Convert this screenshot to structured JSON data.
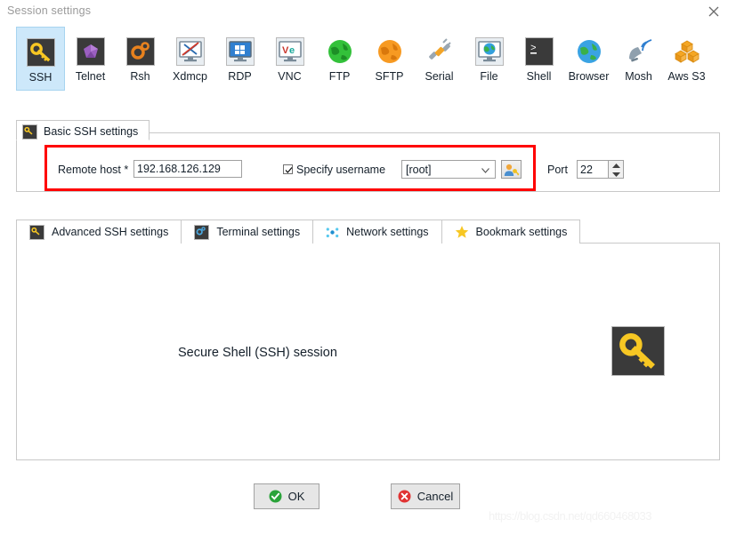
{
  "window": {
    "title": "Session settings",
    "close_icon": "close-icon"
  },
  "toolbar": {
    "protocols": [
      {
        "label": "SSH",
        "icon": "key-icon",
        "selected": true
      },
      {
        "label": "Telnet",
        "icon": "purple-gem-icon",
        "selected": false
      },
      {
        "label": "Rsh",
        "icon": "orange-gears-icon",
        "selected": false
      },
      {
        "label": "Xdmcp",
        "icon": "x-monitor-icon",
        "selected": false
      },
      {
        "label": "RDP",
        "icon": "windows-monitor-icon",
        "selected": false
      },
      {
        "label": "VNC",
        "icon": "vnc-monitor-icon",
        "selected": false
      },
      {
        "label": "FTP",
        "icon": "green-globe-icon",
        "selected": false
      },
      {
        "label": "SFTP",
        "icon": "orange-globe-icon",
        "selected": false
      },
      {
        "label": "Serial",
        "icon": "serial-plug-icon",
        "selected": false
      },
      {
        "label": "File",
        "icon": "file-monitor-icon",
        "selected": false
      },
      {
        "label": "Shell",
        "icon": "terminal-icon",
        "selected": false
      },
      {
        "label": "Browser",
        "icon": "blue-globe-icon",
        "selected": false
      },
      {
        "label": "Mosh",
        "icon": "satellite-icon",
        "selected": false
      },
      {
        "label": "Aws S3",
        "icon": "aws-boxes-icon",
        "selected": false
      }
    ]
  },
  "basic_settings": {
    "group_tab_label": "Basic SSH settings",
    "group_tab_icon": "key-icon",
    "remote_host_label": "Remote host *",
    "remote_host_value": "192.168.126.129",
    "remote_host_placeholder": "",
    "specify_username_label": "Specify username",
    "specify_username_checked": true,
    "username_value": "[root]",
    "username_options": [
      "[root]"
    ],
    "user_picker_icon": "user-key-icon",
    "port_label": "Port",
    "port_value": "22",
    "spinner_up_icon": "chevron-up-icon",
    "spinner_down_icon": "chevron-down-icon",
    "highlight_color": "#ff0000"
  },
  "tabs": [
    {
      "label": "Advanced SSH settings",
      "icon": "key-icon"
    },
    {
      "label": "Terminal settings",
      "icon": "terminal-gear-icon"
    },
    {
      "label": "Network settings",
      "icon": "network-nodes-icon"
    },
    {
      "label": "Bookmark settings",
      "icon": "star-icon"
    }
  ],
  "content": {
    "description": "Secure Shell (SSH) session",
    "session_icon": "key-icon"
  },
  "buttons": {
    "ok_label": "OK",
    "ok_icon": "check-circle-icon",
    "cancel_label": "Cancel",
    "cancel_icon": "x-circle-icon"
  },
  "watermark": {
    "text": "https://blog.csdn.net/qd660468033"
  },
  "colors": {
    "accent": "#cde8fa",
    "highlight": "#ff0000",
    "ok_green": "#2aa33a",
    "cancel_red": "#e03232",
    "key_yellow": "#f7c723"
  }
}
